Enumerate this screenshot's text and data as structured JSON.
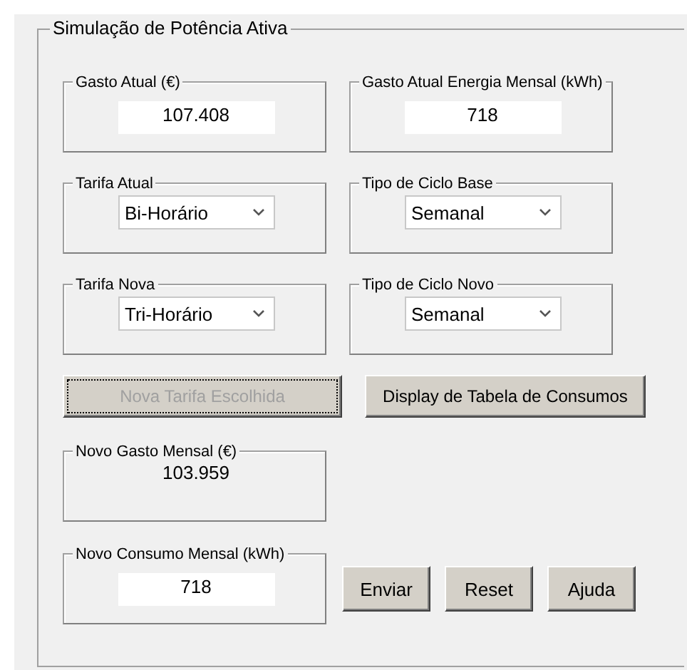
{
  "panel": {
    "title": "Simulação de Potência Ativa"
  },
  "groups": [
    {
      "label": "Gasto Atual (€)",
      "kind": "field",
      "value": "107.408"
    },
    {
      "label": "Gasto Atual Energia Mensal (kWh)",
      "kind": "field",
      "value": "718"
    },
    {
      "label": "Tarifa Atual",
      "kind": "select",
      "value": "Bi-Horário"
    },
    {
      "label": "Tipo de Ciclo Base",
      "kind": "select",
      "value": "Semanal"
    },
    {
      "label": "Tarifa Nova",
      "kind": "select",
      "value": "Tri-Horário"
    },
    {
      "label": "Tipo de Ciclo Novo",
      "kind": "select",
      "value": "Semanal"
    }
  ],
  "buttons": [
    {
      "label": "Nova Tarifa Escolhida",
      "disabled": true,
      "focused": true
    },
    {
      "label": "Display de Tabela de Consumos",
      "disabled": false,
      "focused": false
    }
  ],
  "result": {
    "label": "Novo Gasto Mensal (€)",
    "kind": "text",
    "value": "103.959"
  },
  "consumption": {
    "label": "Novo Consumo Mensal (kWh)",
    "kind": "field",
    "value": "718"
  },
  "actions": [
    "Enviar",
    "Reset",
    "Ajuda"
  ]
}
